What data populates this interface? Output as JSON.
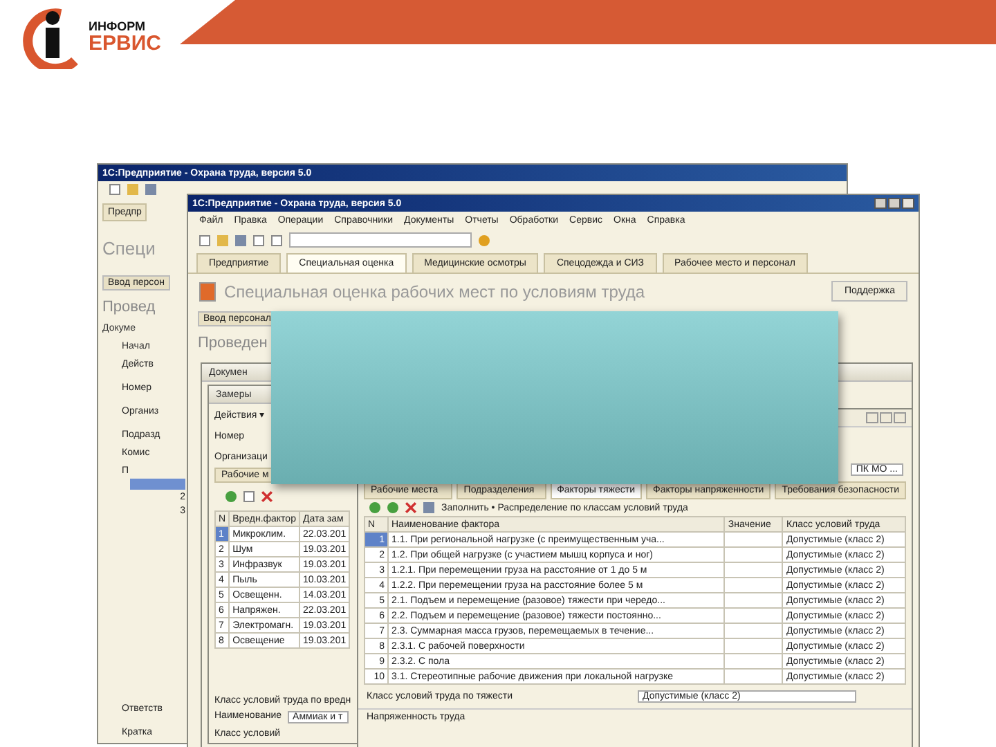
{
  "header": {
    "logo_top": "ИНФОРМ",
    "logo_bottom": "ЕРВИС"
  },
  "back_window": {
    "title": "1С:Предприятие - Охрана труда, версия 5.0",
    "tab": "Предпр",
    "heading": "Специ",
    "button": "Ввод персон",
    "section": "Провед",
    "doc_title": "Докуме",
    "inner_title": "Начал",
    "actions": "Действ",
    "fields": [
      "Номер",
      "Организ",
      "Подразд"
    ],
    "subtab": "Комис",
    "column": "П",
    "rows": [
      {
        "selected": true
      },
      {
        "n": "2",
        "selected": false
      },
      {
        "n": "3",
        "selected": false
      }
    ],
    "footer_fields": [
      "Ответств",
      "Кратка"
    ]
  },
  "front_window": {
    "title": "1С:Предприятие - Охрана труда, версия 5.0",
    "menu": [
      "Файл",
      "Правка",
      "Операции",
      "Справочники",
      "Документы",
      "Отчеты",
      "Обработки",
      "Сервис",
      "Окна",
      "Справка"
    ],
    "tabs": [
      {
        "label": "Предприятие",
        "selected": false
      },
      {
        "label": "Специальная оценка",
        "selected": true
      },
      {
        "label": "Медицинские осмотры",
        "selected": false
      },
      {
        "label": "Спецодежда и СИЗ",
        "selected": false
      },
      {
        "label": "Рабочее место и персонал",
        "selected": false
      }
    ],
    "heading": "Специальная оценка рабочих мест по условиям труда",
    "help_button": "Поддержка",
    "button": "Ввод персонал",
    "section": "Проведен"
  },
  "doc_window": {
    "title": "Докумен"
  },
  "measure_window": {
    "title": "Замеры",
    "actions": "Действия ▾",
    "fields": [
      "Номер",
      "Организаци"
    ],
    "subtab": "Рабочие м",
    "columns": [
      "N",
      "Вредн.фактор",
      "Дата зам"
    ],
    "rows": [
      {
        "n": "1",
        "factor": "Микроклим.",
        "date": "22.03.201",
        "selected": true
      },
      {
        "n": "2",
        "factor": "Шум",
        "date": "19.03.201",
        "selected": false
      },
      {
        "n": "3",
        "factor": "Инфразвук",
        "date": "19.03.201",
        "selected": false
      },
      {
        "n": "4",
        "factor": "Пыль",
        "date": "10.03.201",
        "selected": false
      },
      {
        "n": "5",
        "factor": "Освещенн.",
        "date": "14.03.201",
        "selected": false
      },
      {
        "n": "6",
        "factor": "Напряжен.",
        "date": "22.03.201",
        "selected": false
      },
      {
        "n": "7",
        "factor": "Электромагн.",
        "date": "19.03.201",
        "selected": false
      },
      {
        "n": "8",
        "factor": "Освещение",
        "date": "19.03.201",
        "selected": false
      }
    ],
    "footer_label": "Класс условий труда по вредн",
    "bottom_fields": [
      {
        "label": "Наименование",
        "value": "Аммиак и т"
      },
      {
        "label": "Класс условий"
      }
    ]
  },
  "factor_window": {
    "org_field": "ПК МО ...",
    "tabs": [
      {
        "label": "Рабочие места",
        "selected": false
      },
      {
        "label": "Подразделения",
        "selected": false
      },
      {
        "label": "Факторы тяжести",
        "selected": true
      },
      {
        "label": "Факторы напряженности",
        "selected": false
      },
      {
        "label": "Требования безопасности",
        "selected": false
      }
    ],
    "toolbar_text": "Заполнить • Распределение по классам условий труда",
    "columns": [
      "N",
      "Наименование фактора",
      "Значение",
      "Класс условий труда"
    ],
    "rows": [
      {
        "n": "1",
        "name": "1.1. При региональной нагрузке (с преимущественным уча...",
        "class": "Допустимые (класс 2)",
        "selected": true
      },
      {
        "n": "2",
        "name": "1.2. При общей нагрузке (с участием мышц корпуса и ног)",
        "class": "Допустимые (класс 2)",
        "selected": false
      },
      {
        "n": "3",
        "name": "1.2.1. При перемещении груза на расстояние от 1 до 5 м",
        "class": "Допустимые (класс 2)",
        "selected": false
      },
      {
        "n": "4",
        "name": "1.2.2. При перемещении груза на расстояние более 5 м",
        "class": "Допустимые (класс 2)",
        "selected": false
      },
      {
        "n": "5",
        "name": "2.1. Подъем и перемещение (разовое) тяжести при чередо...",
        "class": "Допустимые (класс 2)",
        "selected": false
      },
      {
        "n": "6",
        "name": "2.2. Подъем и перемещение (разовое) тяжести постоянно...",
        "class": "Допустимые (класс 2)",
        "selected": false
      },
      {
        "n": "7",
        "name": "2.3. Суммарная масса грузов, перемещаемых в течение...",
        "class": "Допустимые (класс 2)",
        "selected": false
      },
      {
        "n": "8",
        "name": "2.3.1. С рабочей поверхности",
        "class": "Допустимые (класс 2)",
        "selected": false
      },
      {
        "n": "9",
        "name": "2.3.2. С пола",
        "class": "Допустимые (класс 2)",
        "selected": false
      },
      {
        "n": "10",
        "name": "3.1. Стереотипные рабочие движения при локальной нагрузке",
        "class": "Допустимые (класс 2)",
        "selected": false
      }
    ],
    "summary_label": "Класс условий труда по тяжести",
    "summary_value": "Допустимые (класс 2)",
    "status": "Напряженность труда"
  }
}
